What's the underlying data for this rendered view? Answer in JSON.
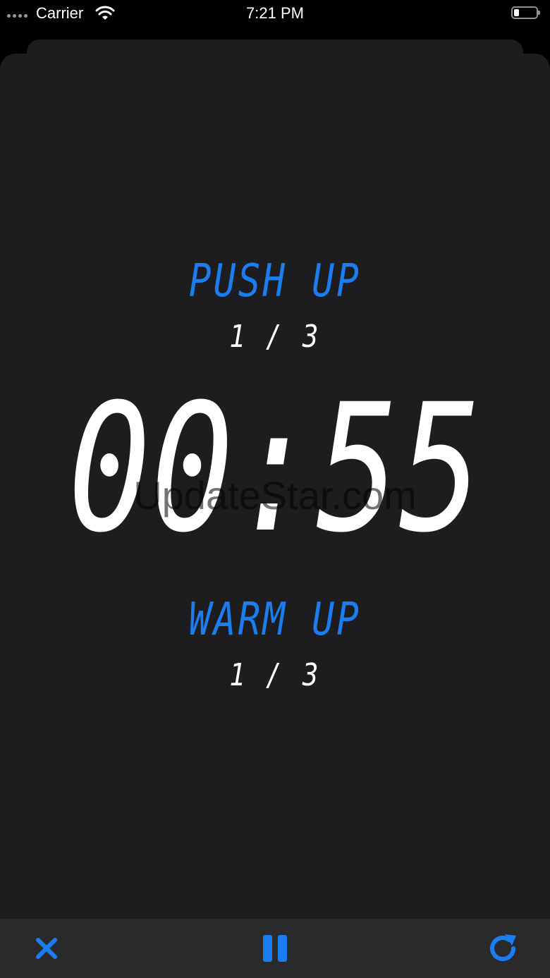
{
  "status_bar": {
    "carrier": "Carrier",
    "time": "7:21 PM",
    "battery_level": 0.15
  },
  "workout": {
    "exercise_name": "PUSH UP",
    "exercise_count": "1 / 3",
    "timer": "00:55",
    "phase_name": "WARM UP",
    "phase_count": "1 / 3"
  },
  "watermark": "UpdateStar.com",
  "toolbar": {
    "close_icon": "xmark-icon",
    "pause_icon": "pause-icon",
    "restart_icon": "arrow-clockwise-icon"
  },
  "colors": {
    "accent": "#1a7ef0",
    "background": "#1d1d1f",
    "toolbar": "#2a2a2c"
  }
}
